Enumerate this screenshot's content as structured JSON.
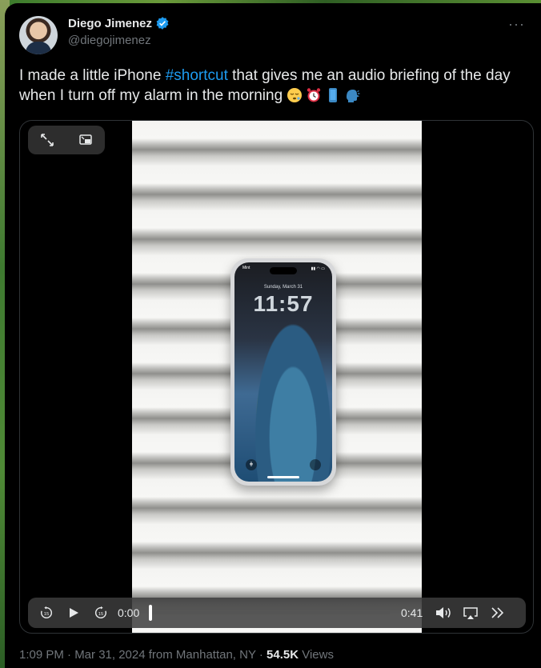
{
  "author": {
    "name": "Diego Jimenez",
    "handle": "@diegojimenez",
    "verified": true
  },
  "menu": {
    "more_label": "···"
  },
  "tweet": {
    "text_before": "I made a little iPhone ",
    "hashtag": "#shortcut",
    "text_after": " that gives me an audio briefing of the day when I turn off my alarm in the morning",
    "emojis": [
      "sleepy-face",
      "alarm-clock",
      "mobile-phone",
      "speaking-head"
    ]
  },
  "video": {
    "phone_screen": {
      "carrier": "Mint",
      "date": "Sunday, March 31",
      "time": "11:57"
    },
    "controls": {
      "current_time": "0:00",
      "total_time": "0:41",
      "progress": 0.0,
      "icons": [
        "expand-icon",
        "picture-in-picture-icon",
        "rewind-15-icon",
        "play-icon",
        "forward-15-icon",
        "volume-icon",
        "airplay-icon",
        "skip-forward-icon"
      ]
    }
  },
  "footer": {
    "timestamp": "1:09 PM · Mar 31, 2024 from Manhattan, NY · ",
    "views_count": "54.5K",
    "views_label": " Views"
  },
  "colors": {
    "background": "#000000",
    "text": "#e7e9ea",
    "secondary": "#71767b",
    "accent": "#1d9bf0"
  }
}
